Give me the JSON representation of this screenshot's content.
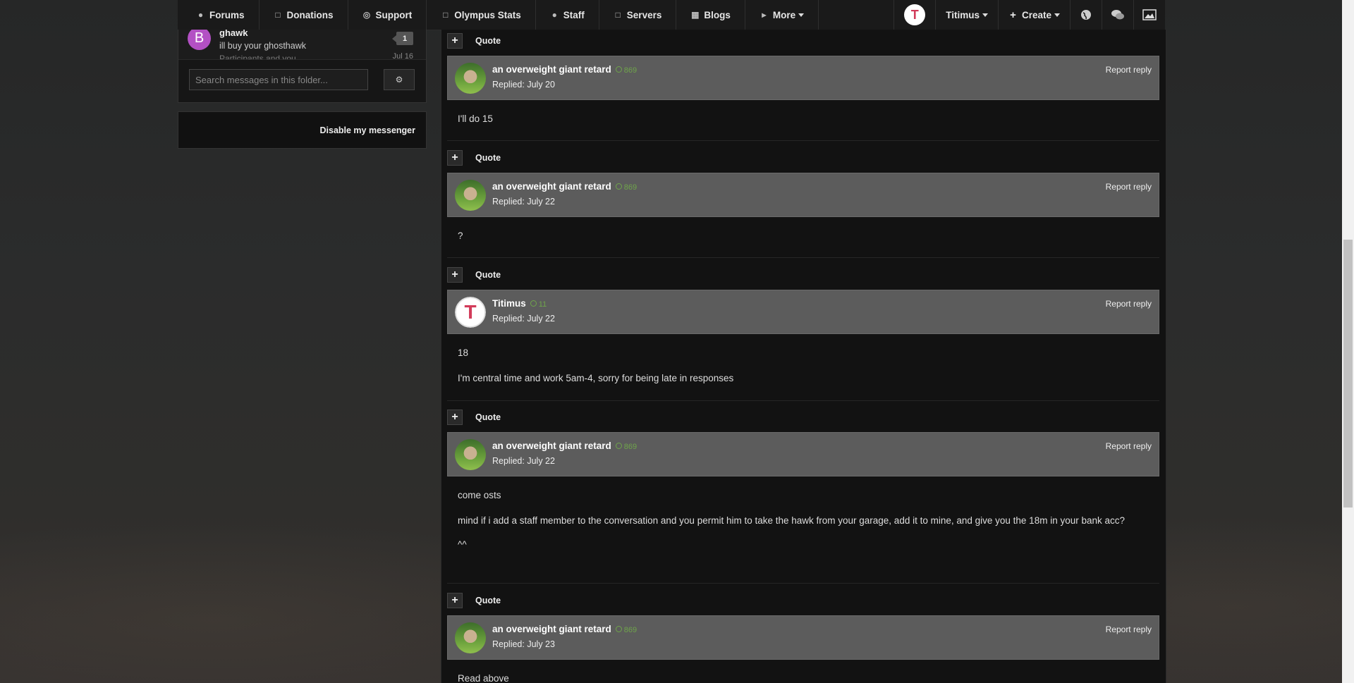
{
  "nav": {
    "items": [
      {
        "label": "Forums",
        "icon": "comments-icon"
      },
      {
        "label": "Donations",
        "icon": "document-icon"
      },
      {
        "label": "Support",
        "icon": "life-ring-icon"
      },
      {
        "label": "Olympus Stats",
        "icon": "document-icon"
      },
      {
        "label": "Staff",
        "icon": "user-icon"
      },
      {
        "label": "Servers",
        "icon": "document-icon"
      },
      {
        "label": "Blogs",
        "icon": "book-icon"
      },
      {
        "label": "More",
        "icon": "megaphone-icon"
      }
    ],
    "user_name": "Titimus",
    "user_initial": "T",
    "create_label": "Create"
  },
  "sidebar": {
    "conversation": {
      "avatar_letter": "B",
      "name": "ghawk",
      "snippet": "ill buy your ghosthawk",
      "snippet2": "Participants and you",
      "badge": "1",
      "date": "Jul 16"
    },
    "search_placeholder": "Search messages in this folder...",
    "disable_label": "Disable my messenger"
  },
  "posts": [
    {
      "author": "an overweight giant retard",
      "rep": "869",
      "date": "Replied: July 20",
      "body": [
        "I'll do 15"
      ],
      "avatar": "dog"
    },
    {
      "author": "an overweight giant retard",
      "rep": "869",
      "date": "Replied: July 22",
      "body": [
        "?"
      ],
      "avatar": "dog"
    },
    {
      "author": "Titimus",
      "rep": "11",
      "date": "Replied: July 22",
      "body": [
        "18",
        "I'm central time and work 5am-4, sorry for being late in responses"
      ],
      "avatar": "t"
    },
    {
      "author": "an overweight giant retard",
      "rep": "869",
      "date": "Replied: July 22",
      "body": [
        "come osts",
        "mind if i add a staff member to the conversation and you permit him to take the hawk from your garage, add it to mine, and give you the 18m in your bank acc?",
        "^^"
      ],
      "avatar": "dog"
    },
    {
      "author": "an overweight giant retard",
      "rep": "869",
      "date": "Replied: July 23",
      "body": [
        "Read above"
      ],
      "avatar": "dog"
    }
  ],
  "quote_label": "Quote",
  "report_label": "Report reply",
  "colors": {
    "rep_green": "#6fa54a",
    "header_bg": "#5c5c5c",
    "nav_bg": "#1a1a1a"
  }
}
